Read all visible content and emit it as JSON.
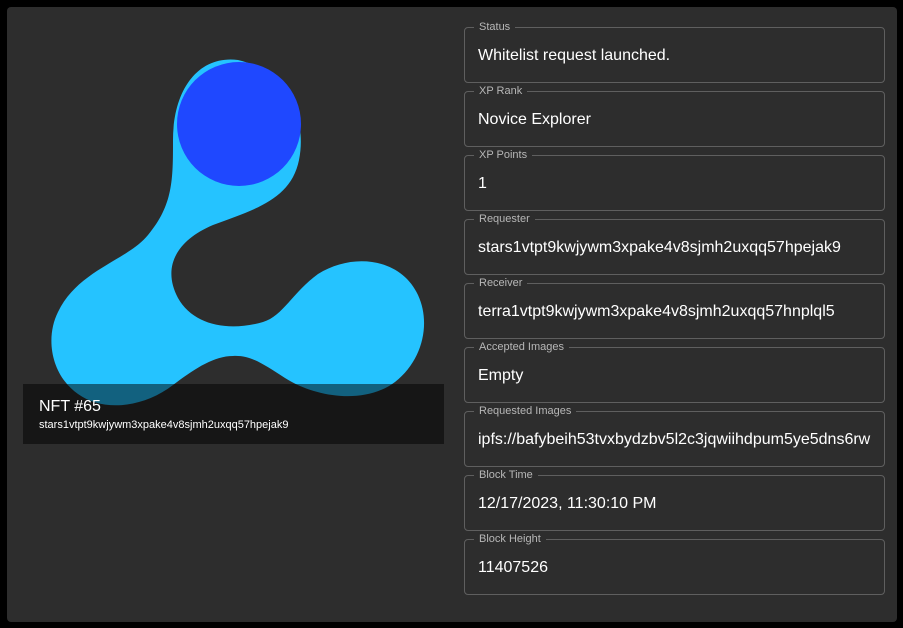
{
  "nft": {
    "title": "NFT #65",
    "owner": "stars1vtpt9kwjywm3xpake4v8sjmh2uxqq57hpejak9",
    "image_icon": "stargaze-logo-icon",
    "colors": {
      "logo_light": "#25c3ff",
      "logo_dark": "#1f48ff",
      "caption_bg": "rgba(0,0,0,0.5)"
    }
  },
  "fields": [
    {
      "label": "Status",
      "value": "Whitelist request launched."
    },
    {
      "label": "XP Rank",
      "value": "Novice Explorer"
    },
    {
      "label": "XP Points",
      "value": "1"
    },
    {
      "label": "Requester",
      "value": "stars1vtpt9kwjywm3xpake4v8sjmh2uxqq57hpejak9"
    },
    {
      "label": "Receiver",
      "value": "terra1vtpt9kwjywm3xpake4v8sjmh2uxqq57hnplql5"
    },
    {
      "label": "Accepted Images",
      "value": "Empty"
    },
    {
      "label": "Requested Images",
      "value": "ipfs://bafybeih53tvxbydzbv5l2c3jqwiihdpum5ye5dns6rw"
    },
    {
      "label": "Block Time",
      "value": "12/17/2023, 11:30:10 PM"
    },
    {
      "label": "Block Height",
      "value": "11407526"
    }
  ]
}
